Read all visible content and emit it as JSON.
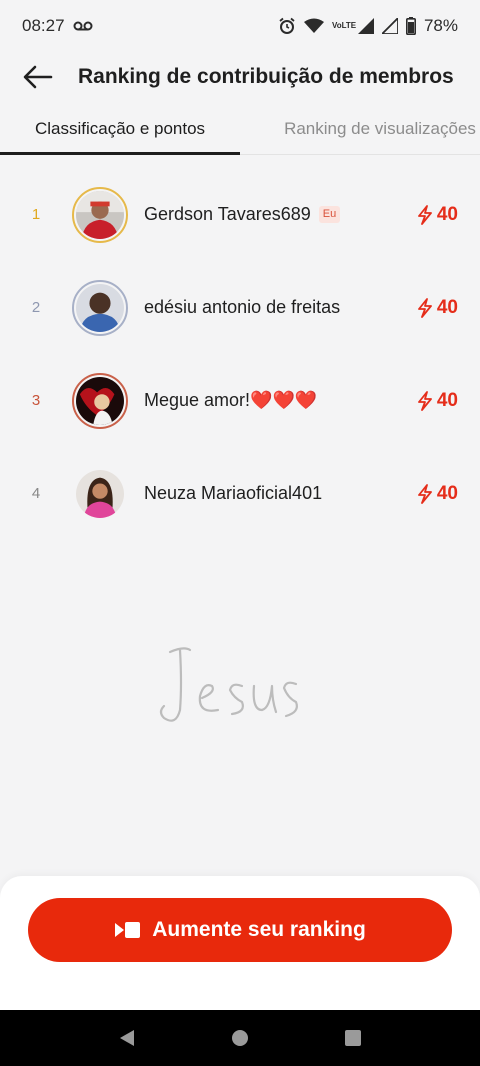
{
  "status_bar": {
    "time": "08:27",
    "voicemail_icon": "voicemail-icon",
    "alarm_icon": "alarm-icon",
    "wifi_icon": "wifi-icon",
    "volte_label": "VoLTE",
    "battery": "78%"
  },
  "header": {
    "title": "Ranking de contribuição de membros",
    "back_icon": "arrow-left-icon"
  },
  "tabs": [
    {
      "label": "Classificação e pontos",
      "active": true
    },
    {
      "label": "Ranking de visualizações",
      "active": false
    }
  ],
  "ranking": [
    {
      "rank": "1",
      "name": "Gerdson Tavares689",
      "badge": "Eu",
      "points": "40",
      "rank_color": "#e0a81e",
      "ring_color": "#e6b94a"
    },
    {
      "rank": "2",
      "name": "edésiu antonio de freitas",
      "badge": "",
      "points": "40",
      "rank_color": "#8e97b0",
      "ring_color": "#a7b0c7"
    },
    {
      "rank": "3",
      "name": "Megue amor!❤️❤️❤️",
      "badge": "",
      "points": "40",
      "rank_color": "#c8543a",
      "ring_color": "#c9614a"
    },
    {
      "rank": "4",
      "name": "Neuza Mariaoficial401",
      "badge": "",
      "points": "40",
      "rank_color": "#888888",
      "ring_color": "#f4f4f5"
    }
  ],
  "watermark": "Jesus",
  "cta": {
    "label": "Aumente seu ranking",
    "icon": "video-icon"
  },
  "colors": {
    "accent": "#e8290c",
    "points": "#e52d1a"
  }
}
